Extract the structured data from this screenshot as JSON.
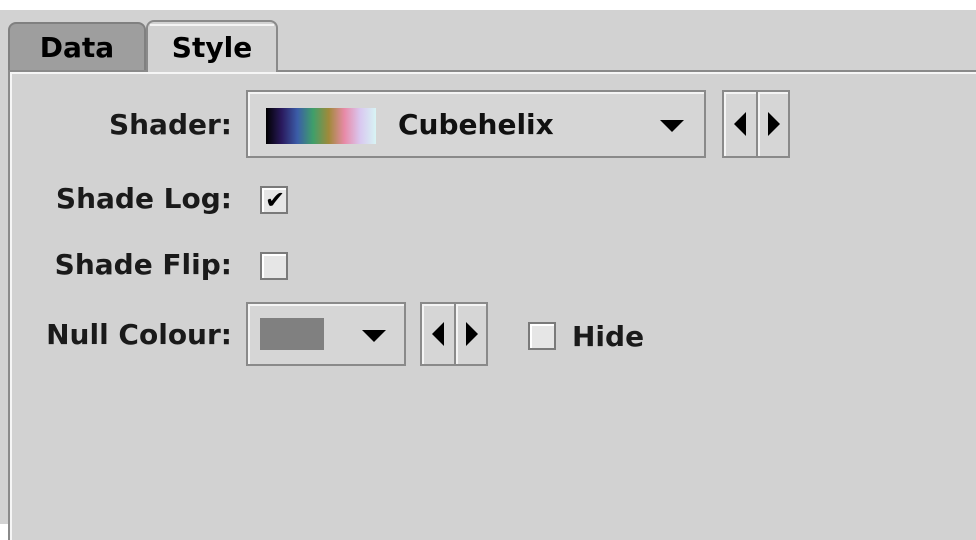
{
  "tabs": [
    {
      "label": "Data",
      "selected": false
    },
    {
      "label": "Style",
      "selected": true
    }
  ],
  "shader": {
    "label": "Shader:",
    "selected": "Cubehelix",
    "swatch_colors": [
      "#000000",
      "#2a1a5e",
      "#3b5da8",
      "#3f9f6a",
      "#a08a3a",
      "#e88aa8",
      "#d9c8f0",
      "#d8f4f4"
    ]
  },
  "shade_log": {
    "label": "Shade Log:",
    "checked": true,
    "glyph": "✔"
  },
  "shade_flip": {
    "label": "Shade Flip:",
    "checked": false
  },
  "null_colour": {
    "label": "Null Colour:",
    "swatch_color": "#808080",
    "hide_label": "Hide",
    "hide_checked": false
  },
  "icons": {
    "dropdown": "chevron-down-icon",
    "previous": "triangle-left-icon",
    "next": "triangle-right-icon"
  }
}
